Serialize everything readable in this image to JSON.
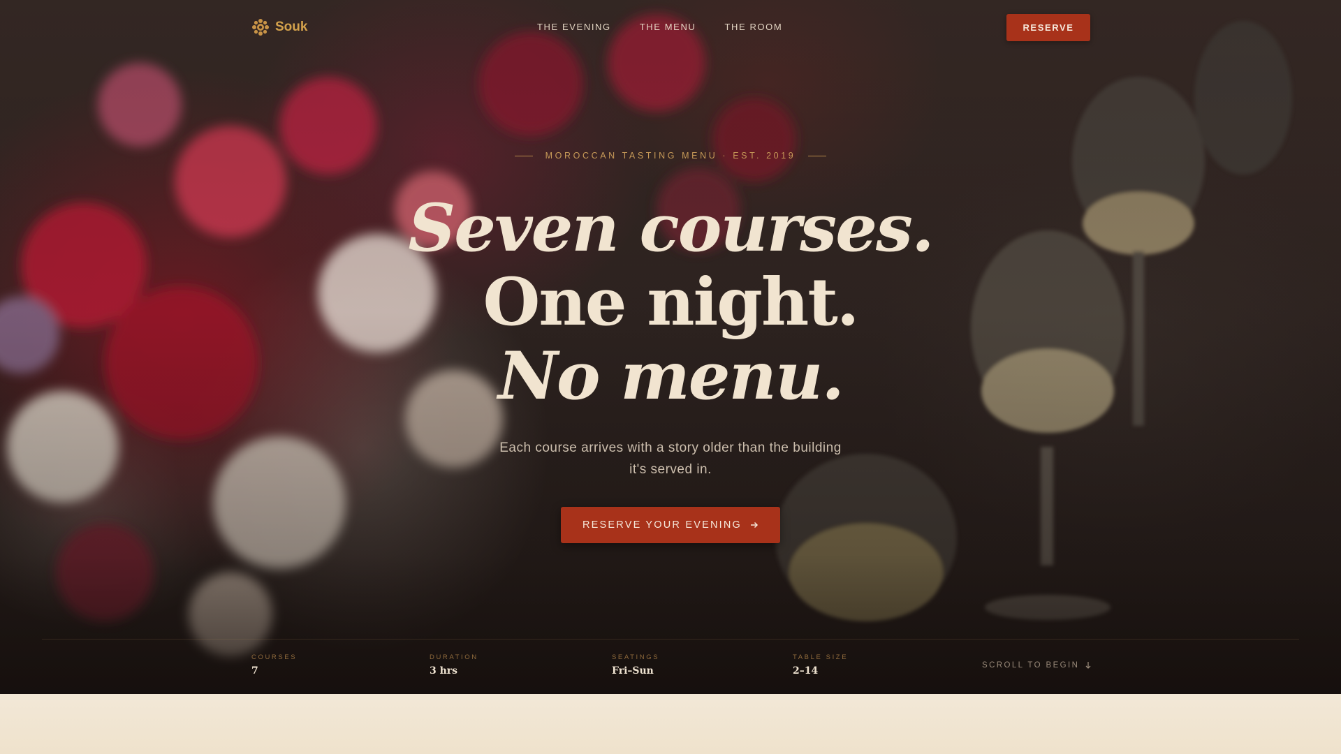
{
  "nav": {
    "brand": "Souk",
    "links": [
      "THE EVENING",
      "THE MENU",
      "THE ROOM"
    ],
    "reserve": "RESERVE"
  },
  "hero": {
    "eyebrow": "MOROCCAN TASTING MENU · EST. 2019",
    "headline": {
      "line1": "Seven courses.",
      "line2": "One night.",
      "line3": "No menu."
    },
    "subtitle": "Each course arrives with a story older than the building it's served in.",
    "cta": "RESERVE YOUR EVENING"
  },
  "stats": [
    {
      "label": "COURSES",
      "value": "7"
    },
    {
      "label": "DURATION",
      "value": "3 hrs"
    },
    {
      "label": "SEATINGS",
      "value": "Fri–Sun"
    },
    {
      "label": "TABLE SIZE",
      "value": "2–14"
    }
  ],
  "scroll": "SCROLL TO BEGIN",
  "colors": {
    "accent": "#a8321a",
    "brand": "#d4a24c",
    "cream": "#f1e4d0",
    "below_section": "#f1e6d2"
  },
  "icons": {
    "brand": "rosette-icon",
    "cta": "arrow-right-icon",
    "scroll": "arrow-down-icon"
  }
}
